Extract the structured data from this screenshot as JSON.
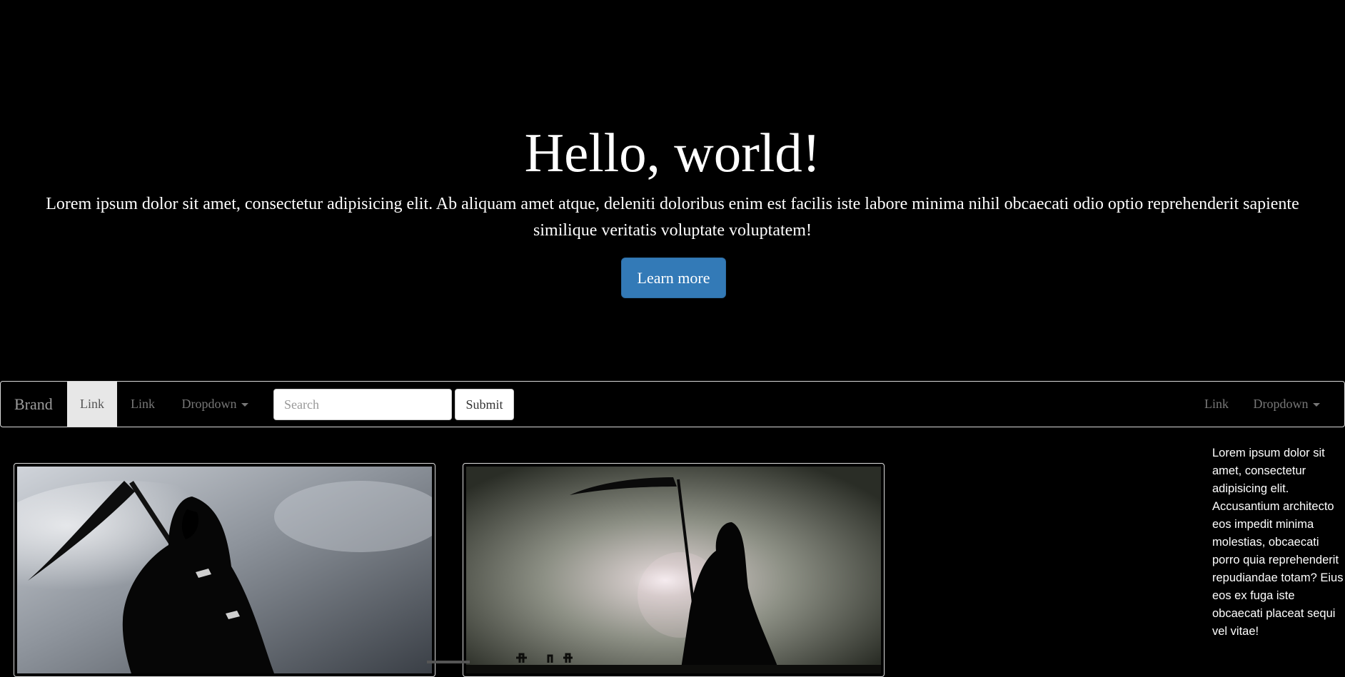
{
  "hero": {
    "title": "Hello, world!",
    "text": "Lorem ipsum dolor sit amet, consectetur adipisicing elit. Ab aliquam amet atque, deleniti doloribus enim est facilis iste labore minima nihil obcaecati odio optio reprehenderit sapiente similique veritatis voluptate voluptatem!",
    "button_label": "Learn more"
  },
  "navbar": {
    "brand": "Brand",
    "links": [
      "Link",
      "Link"
    ],
    "dropdown": "Dropdown",
    "search_placeholder": "Search",
    "submit_label": "Submit",
    "right_link": "Link",
    "right_dropdown": "Dropdown"
  },
  "sidebar": {
    "text": "Lorem ipsum dolor sit amet, consectetur adipisicing elit. Accusantium architecto eos impedit minima molestias, obcaecati porro quia reprehenderit repudiandae totam? Eius eos ex fuga iste obcaecati placeat sequi vel vitae!"
  },
  "colors": {
    "background": "#000000",
    "primary": "#337ab7",
    "active_nav": "#e7e7e7"
  },
  "images": [
    {
      "icon": "grim-reaper-cloudy-sky-image"
    },
    {
      "icon": "grim-reaper-silhouette-image"
    }
  ]
}
